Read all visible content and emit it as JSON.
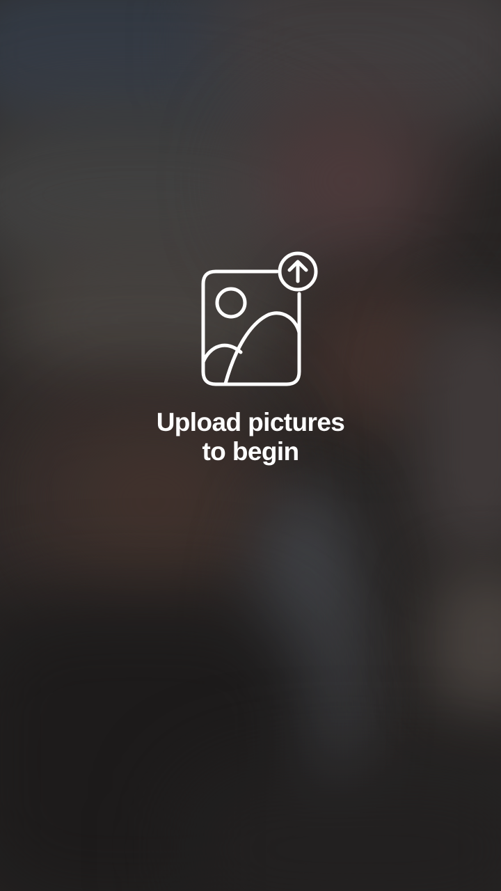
{
  "upload_prompt": {
    "line1": "Upload pictures",
    "line2": "to begin",
    "icon": "image-upload-icon"
  },
  "colors": {
    "foreground": "#ffffff",
    "background": "#2b2928"
  }
}
